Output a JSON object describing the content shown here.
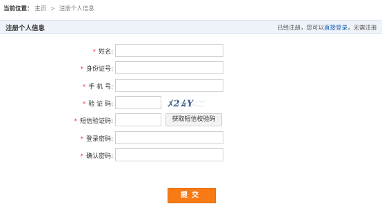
{
  "breadcrumb": {
    "prefix": "当前位置：",
    "home": "主页",
    "separator": ">",
    "current": "注册个人信息"
  },
  "section": {
    "title": "注册个人信息",
    "note_before": "已经注册，您可以",
    "note_link": "直接登录",
    "note_after": "，无需注册"
  },
  "form": {
    "required_mark": "*",
    "name_label": "姓名:",
    "id_label": "身份证号:",
    "phone_label": "手 机 号:",
    "captcha_label": "验 证 码:",
    "captcha_text": "ﾒ2ﾑY",
    "sms_label": "短信验证码:",
    "sms_button": "获取短信校验码",
    "password_label": "登录密码:",
    "confirm_label": "确认密码:"
  },
  "submit": {
    "label": "提交"
  },
  "colors": {
    "accent": "#f77a14",
    "link": "#1a64b4",
    "required": "#e33333"
  }
}
